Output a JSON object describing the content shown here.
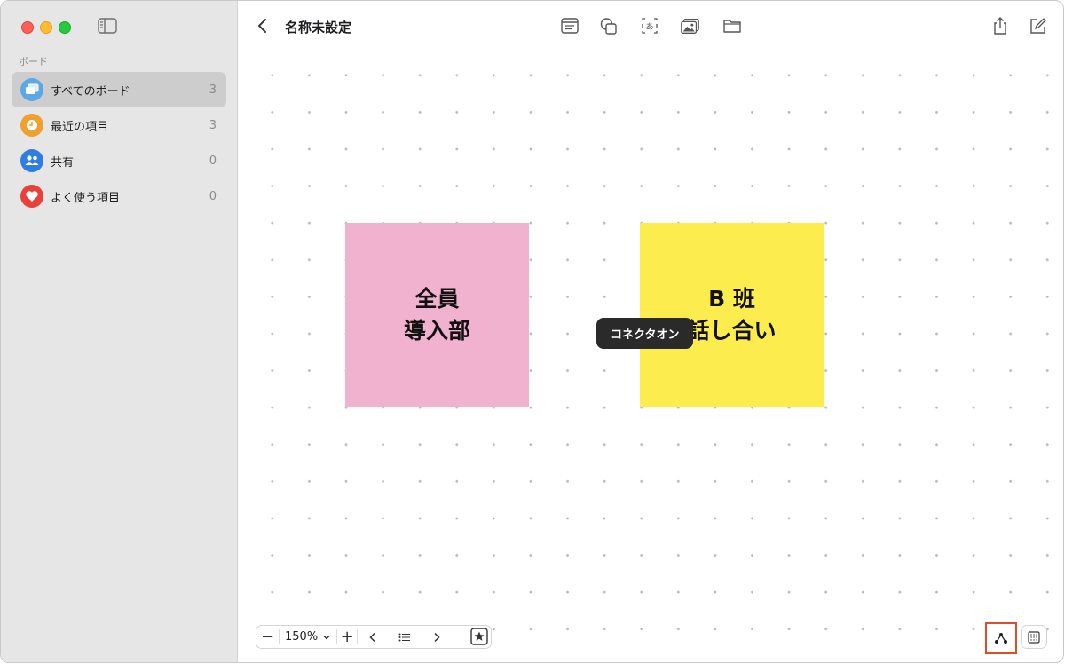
{
  "window": {
    "title": "名称未設定"
  },
  "sidebar": {
    "section_label": "ボード",
    "items": [
      {
        "label": "すべてのボード",
        "count": "3",
        "icon": "boards-icon",
        "color": "#5aa9e6",
        "active": true
      },
      {
        "label": "最近の項目",
        "count": "3",
        "icon": "clock-icon",
        "color": "#f0a030",
        "active": false
      },
      {
        "label": "共有",
        "count": "0",
        "icon": "people-icon",
        "color": "#2f7de1",
        "active": false
      },
      {
        "label": "よく使う項目",
        "count": "0",
        "icon": "heart-icon",
        "color": "#e8413c",
        "active": false
      }
    ]
  },
  "toolbar": {
    "icons": [
      "text-box-icon",
      "shapes-icon",
      "text-icon",
      "media-icon",
      "folder-icon"
    ],
    "right_icons": [
      "share-icon",
      "compose-icon"
    ]
  },
  "canvas": {
    "stickies": [
      {
        "text": "全員\n導入部",
        "color": "#f0b2cf"
      },
      {
        "text": "B 班\n話し合い",
        "color": "#fdec4e"
      }
    ],
    "tooltip": "コネクタオン"
  },
  "bottom_bar": {
    "zoom_minus": "−",
    "zoom_value": "150%",
    "zoom_plus": "+",
    "accent": "#e04b2d"
  }
}
